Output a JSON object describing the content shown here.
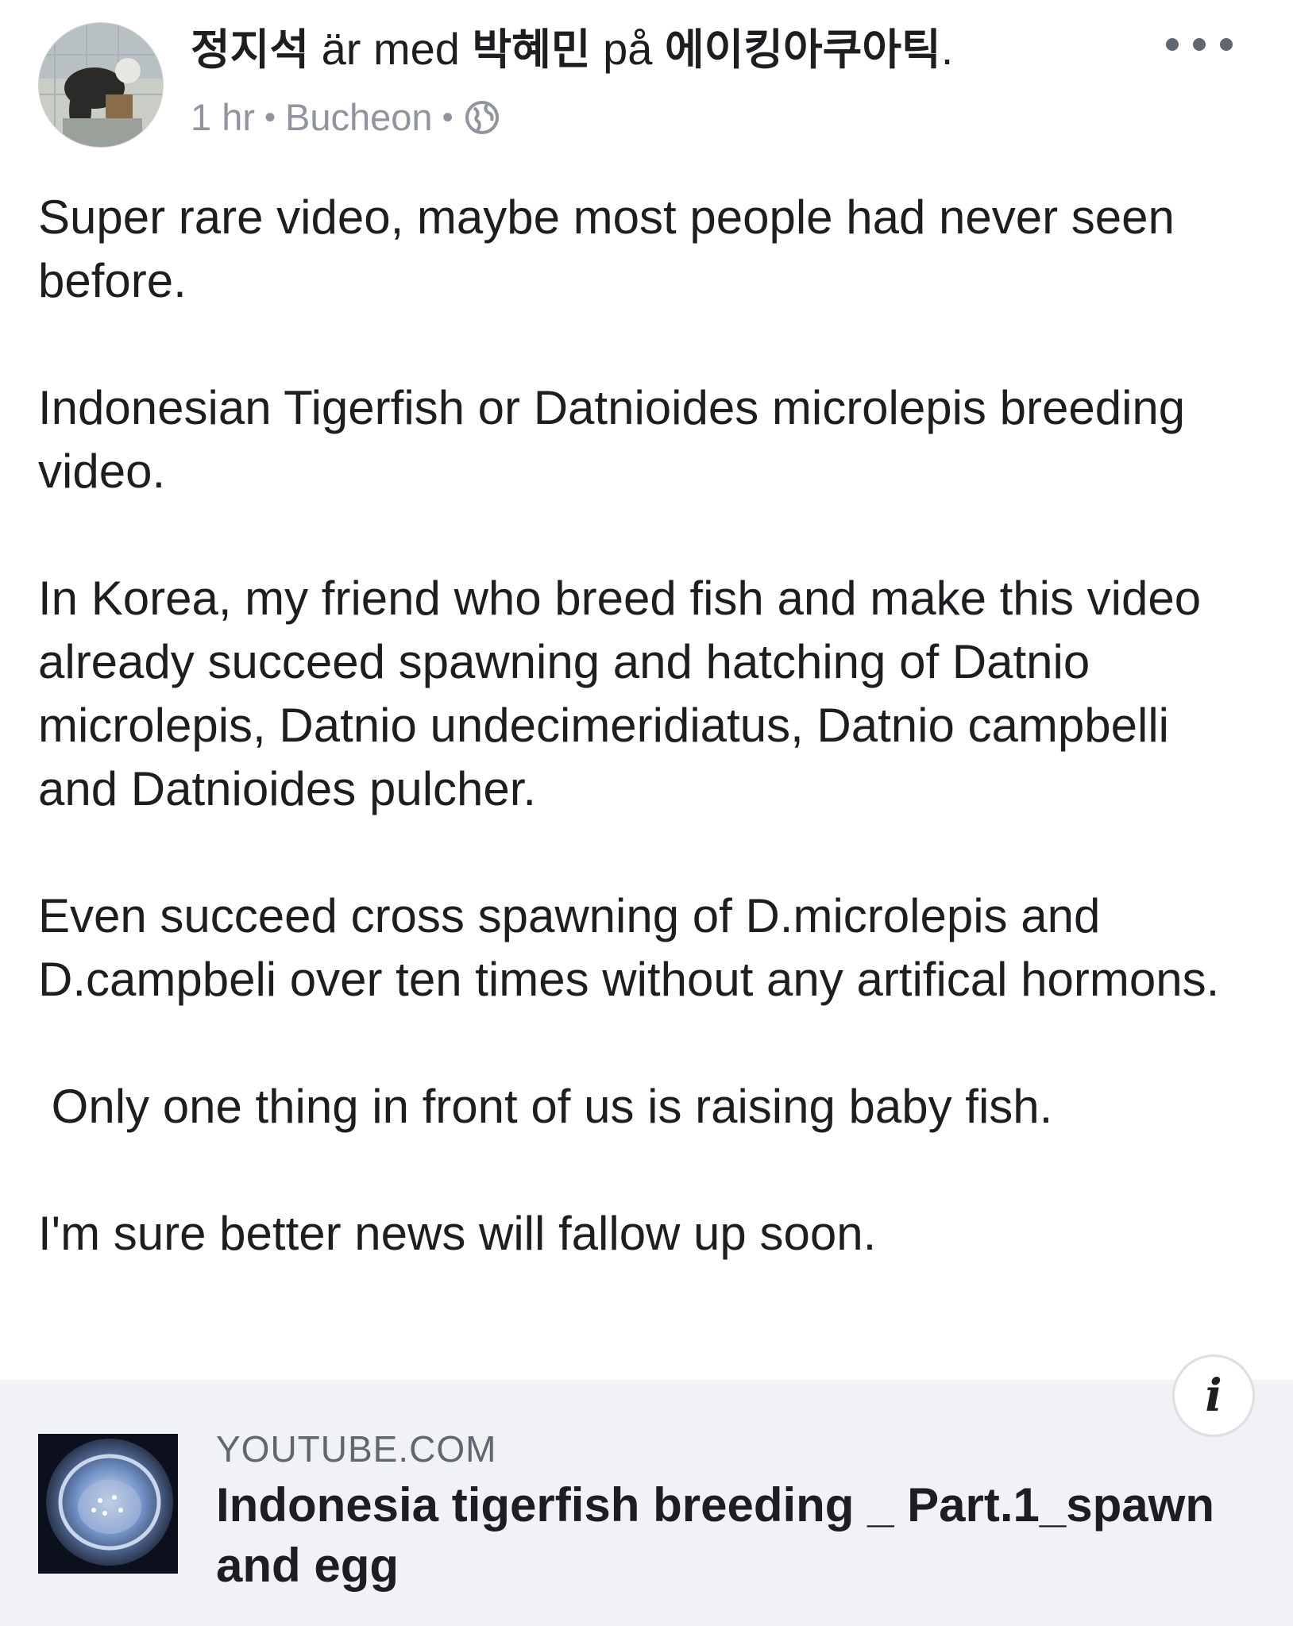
{
  "post": {
    "author": "정지석",
    "with_text": "är med",
    "tagged": "박혜민",
    "at_text": "på",
    "place": "에이킹아쿠아틱",
    "period": ".",
    "time": "1 hr",
    "separator": "•",
    "location": "Bucheon",
    "audience_icon": "globe-icon",
    "more_icon": "ellipsis-icon",
    "paragraphs": [
      "Super rare video, maybe most people had never seen before.",
      "Indonesian Tigerfish or Datnioides microlepis breeding video.",
      "In Korea, my friend who breed fish and make this video already succeed spawning and hatching of Datnio microlepis, Datnio undecimeridiatus, Datnio campbelli and Datnioides pulcher.",
      "Even succeed cross spawning of D.microlepis and D.campbeli over ten times without any artifical hormons.",
      " Only one thing in front of us is raising baby fish.",
      "I'm sure better news will fallow up soon."
    ]
  },
  "link_preview": {
    "domain": "YOUTUBE.COM",
    "title": "Indonesia tigerfish breeding _ Part.1_spawn and egg",
    "info_icon": "info-icon",
    "info_glyph": "i"
  },
  "colors": {
    "text": "#1c1e21",
    "meta": "#90949c",
    "card_background": "#f0f2f5"
  }
}
